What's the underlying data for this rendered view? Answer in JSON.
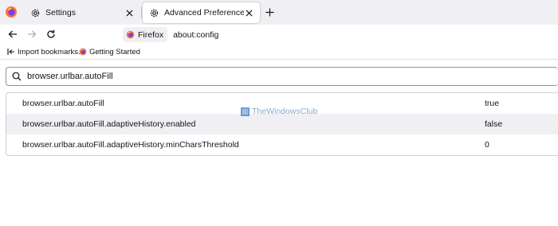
{
  "tabs": [
    {
      "label": "Settings",
      "icon": "gear-icon",
      "active": false
    },
    {
      "label": "Advanced Preferences",
      "icon": "gear-icon",
      "active": true
    }
  ],
  "navbar": {
    "identity_label": "Firefox",
    "url": "about:config"
  },
  "bookmarks": [
    {
      "label": "Import bookmarks...",
      "icon": "import-icon"
    },
    {
      "label": "Getting Started",
      "icon": "firefox-icon"
    }
  ],
  "search": {
    "value": "browser.urlbar.autoFill"
  },
  "prefs": [
    {
      "name": "browser.urlbar.autoFill",
      "value": "true"
    },
    {
      "name": "browser.urlbar.autoFill.adaptiveHistory.enabled",
      "value": "false"
    },
    {
      "name": "browser.urlbar.autoFill.adaptiveHistory.minCharsThreshold",
      "value": "0"
    }
  ],
  "watermark": {
    "text": "TheWindowsClub"
  },
  "colors": {
    "tabstrip_bg": "#f0f0f4",
    "row_alt_bg": "#f0f0f4",
    "watermark": "#7aa0c8"
  }
}
